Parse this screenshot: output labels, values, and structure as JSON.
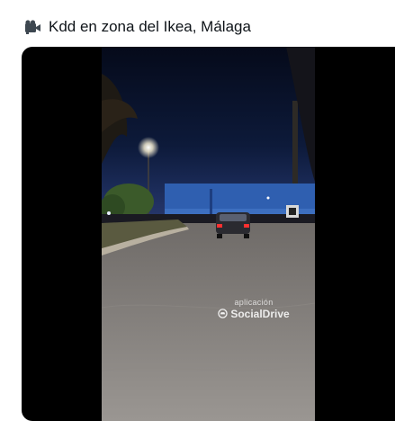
{
  "post": {
    "title": "Kdd en zona del Ikea, Málaga",
    "title_icon": "video-camera-icon"
  },
  "video": {
    "watermark_top": "aplicación",
    "watermark_brand": "SocialDrive"
  }
}
